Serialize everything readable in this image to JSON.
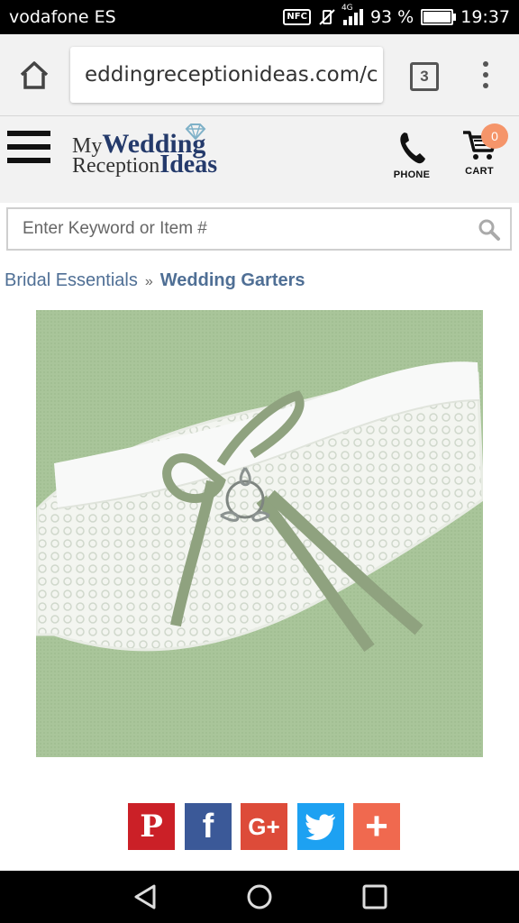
{
  "status_bar": {
    "carrier": "vodafone ES",
    "nfc_label": "NFC",
    "network": "4G",
    "battery_percent": "93 %",
    "battery_level": 0.93,
    "time": "19:37"
  },
  "browser": {
    "url": "eddingreceptionideas.com/c",
    "tab_count": "3"
  },
  "site": {
    "logo_line1_a": "My",
    "logo_line1_b": "Wedding",
    "logo_line2_a": "Reception",
    "logo_line2_b": "Ideas",
    "phone_label": "PHONE",
    "cart_label": "CART",
    "cart_count": "0"
  },
  "search": {
    "placeholder": "Enter Keyword or Item #"
  },
  "breadcrumb": {
    "parent": "Bridal Essentials",
    "separator": "»",
    "current": "Wedding Garters"
  },
  "share": {
    "pinterest_glyph": "P",
    "facebook_glyph": "f",
    "googleplus_glyph": "G+",
    "twitter_glyph": "t",
    "more_glyph": "+",
    "colors": {
      "pinterest": "#cb2027",
      "facebook": "#3b5998",
      "googleplus": "#dd4b39",
      "twitter": "#1da1f2",
      "more": "#f0694f"
    }
  },
  "theme": {
    "link_color": "#4f6f95",
    "logo_navy": "#243a6b",
    "cart_badge": "#f5956a",
    "product_bg": "#a9c59a"
  }
}
